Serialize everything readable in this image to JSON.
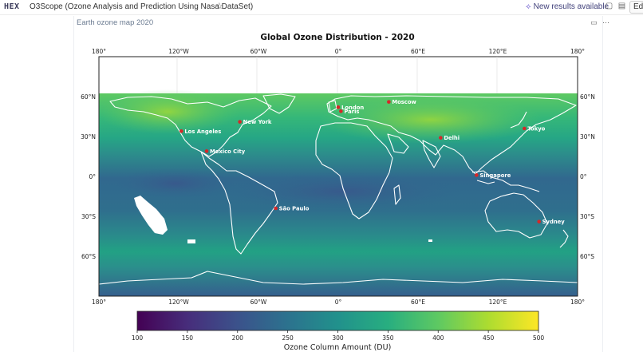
{
  "app": {
    "logo": "HEX",
    "title": "O3Scope (Ozone Analysis and Prediction Using Nasa DataSet)",
    "new_results": "New results available",
    "edit_label": "Ed"
  },
  "cell": {
    "title": "Earth ozone map 2020"
  },
  "icons": {
    "star": "star-icon",
    "comment": "comment-icon",
    "panel": "panel-icon",
    "more": "more-icon",
    "sparkle": "sparkle-icon"
  },
  "chart_data": {
    "type": "heatmap",
    "title": "Global Ozone Distribution - 2020",
    "x_ticks": [
      "180°",
      "120°W",
      "60°W",
      "0°",
      "60°E",
      "120°E",
      "180°"
    ],
    "y_ticks": [
      "60°N",
      "30°N",
      "0°",
      "30°S",
      "60°S"
    ],
    "xlim": [
      -180,
      180
    ],
    "ylim": [
      -90,
      90
    ],
    "colormap": "viridis",
    "colorbar": {
      "label": "Ozone Column Amount (DU)",
      "ticks": [
        "100",
        "150",
        "200",
        "250",
        "300",
        "350",
        "400",
        "450",
        "500"
      ],
      "range": [
        100,
        500
      ]
    },
    "cities": [
      {
        "name": "London",
        "lon": 0,
        "lat": 52
      },
      {
        "name": "Paris",
        "lon": 2,
        "lat": 49
      },
      {
        "name": "Moscow",
        "lon": 38,
        "lat": 56
      },
      {
        "name": "New York",
        "lon": -74,
        "lat": 41
      },
      {
        "name": "Los Angeles",
        "lon": -118,
        "lat": 34
      },
      {
        "name": "Mexico City",
        "lon": -99,
        "lat": 19
      },
      {
        "name": "São Paulo",
        "lon": -47,
        "lat": -24
      },
      {
        "name": "Delhi",
        "lon": 77,
        "lat": 29
      },
      {
        "name": "Tokyo",
        "lon": 140,
        "lat": 36
      },
      {
        "name": "Singapore",
        "lon": 104,
        "lat": 1
      },
      {
        "name": "Sydney",
        "lon": 151,
        "lat": -34
      }
    ],
    "grid": true,
    "legend": "none"
  }
}
